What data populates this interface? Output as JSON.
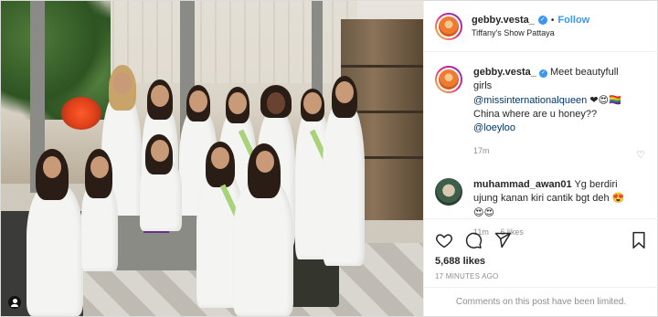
{
  "post": {
    "username": "gebby.vesta_",
    "verified_icon": "verified-badge-icon",
    "follow_label": "Follow",
    "separator": "•",
    "location": "Tiffany's Show Pattaya"
  },
  "caption": {
    "username": "gebby.vesta_",
    "text_before": "Meet beautyfull girls",
    "mention": "@missinternationalqueen",
    "emojis": "❤😍🏳️‍🌈",
    "line2": "China where are u honey??",
    "mention2": "@loeyloo",
    "time": "17m"
  },
  "comments": [
    {
      "username": "muhammad_awan01",
      "text": "Yg berdiri ujung kanan kiri cantik bgt deh 😍",
      "emojis2": "😍😍",
      "time": "11m",
      "likes": "6 likes"
    }
  ],
  "actions": {
    "likes": "5,688 likes",
    "timestamp": "17 MINUTES AGO"
  },
  "footer": {
    "limited_text": "Comments on this post have been limited."
  },
  "colors": {
    "accent": "#3897f0",
    "muted": "#8e8e8e",
    "mention": "#00376b"
  }
}
